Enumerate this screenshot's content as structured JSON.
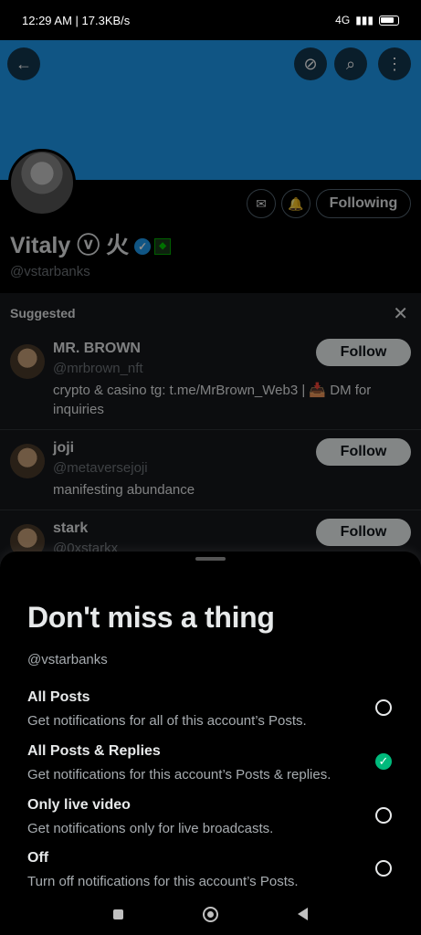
{
  "status_bar": {
    "time_speed": "12:29 AM | 17.3KB/s",
    "network": "4G",
    "icons": [
      "no-signal-icon",
      "whatsapp-icon",
      "telegram-icon",
      "x-icon"
    ]
  },
  "profile": {
    "display_name": "Vitaly ⓥ 火",
    "handle": "@vstarbanks",
    "following_label": "Following",
    "banner_color": "#1d9bf0"
  },
  "suggested": {
    "title": "Suggested",
    "items": [
      {
        "name": "MR. BROWN",
        "handle": "@mrbrown_nft",
        "bio": "crypto & casino  tg: t.me/MrBrown_Web3 | 📥 DM for inquiries",
        "follow_label": "Follow"
      },
      {
        "name": "joji",
        "handle": "@metaversejoji",
        "bio": "manifesting abundance",
        "follow_label": "Follow"
      },
      {
        "name": "stark",
        "handle": "@0xstarkx",
        "bio": "",
        "follow_label": "Follow"
      }
    ]
  },
  "sheet": {
    "title": "Don't miss a thing",
    "handle": "@vstarbanks",
    "options": [
      {
        "title": "All Posts",
        "desc": "Get notifications for all of this account’s Posts.",
        "selected": false
      },
      {
        "title": "All Posts & Replies",
        "desc": "Get notifications for this account’s Posts & replies.",
        "selected": true
      },
      {
        "title": "Only live video",
        "desc": "Get notifications only for live broadcasts.",
        "selected": false
      },
      {
        "title": "Off",
        "desc": "Turn off notifications for this account’s Posts.",
        "selected": false
      }
    ],
    "checkmark": "✓",
    "accent": "#00ba7c"
  }
}
